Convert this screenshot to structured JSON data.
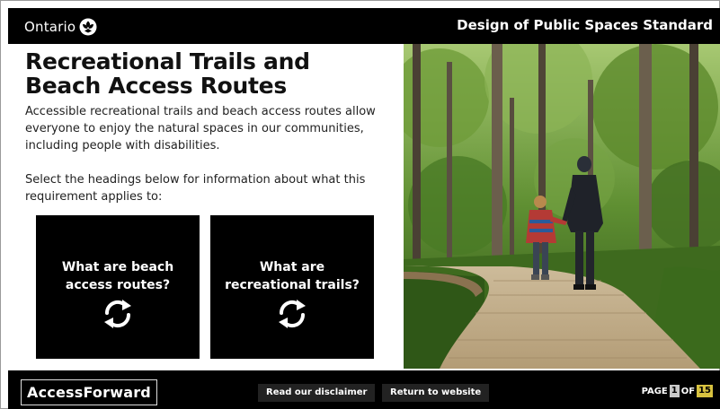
{
  "header": {
    "brand": "Ontario",
    "title": "Design of Public Spaces Standard"
  },
  "main": {
    "title": "Recreational Trails and Beach Access Routes",
    "intro": "Accessible recreational trails and beach access routes allow everyone to enjoy the natural spaces in our communities, including people with disabilities.",
    "prompt": "Select the headings below for information about what this requirement applies to:",
    "cards": [
      {
        "label": "What are beach access routes?",
        "icon": "refresh-icon"
      },
      {
        "label": "What are recreational trails?",
        "icon": "refresh-icon"
      }
    ]
  },
  "photo": {
    "description_icon": "forest-boardwalk-photo"
  },
  "footer": {
    "logo": "AccessForward",
    "disclaimer_button": "Read our disclaimer",
    "return_button": "Return to website",
    "page_prefix": "PAGE",
    "page_current": "1",
    "page_of": "OF",
    "page_total": "15"
  },
  "colors": {
    "header_bg": "#000000",
    "card_bg": "#000000",
    "page_total_highlight": "#d8c240"
  }
}
